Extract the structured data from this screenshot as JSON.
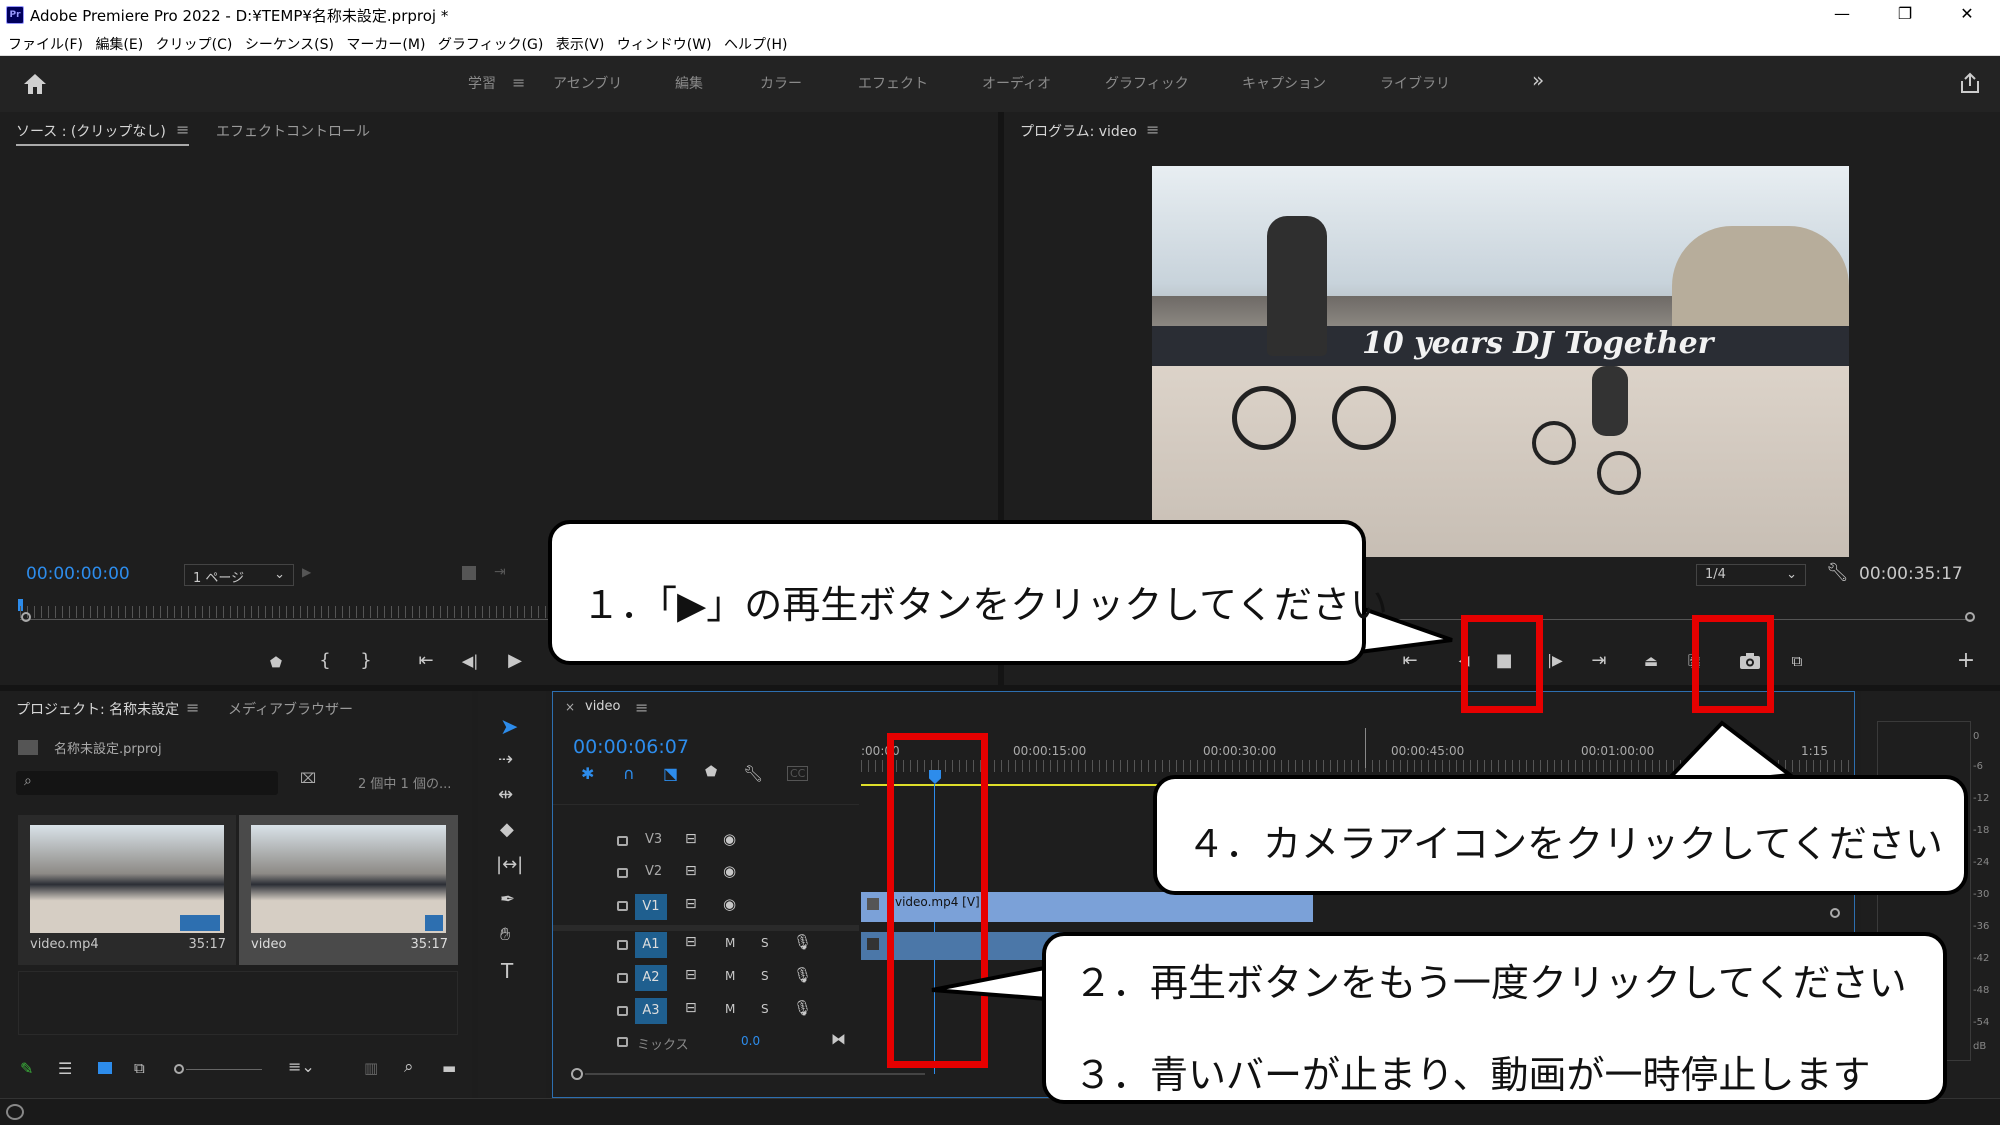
{
  "window": {
    "title": "Adobe Premiere Pro 2022 - D:¥TEMP¥名称未設定.prproj *",
    "app_icon": "Pr",
    "minimize": "—",
    "restore": "❐",
    "close": "✕"
  },
  "menu": [
    "ファイル(F)",
    "編集(E)",
    "クリップ(C)",
    "シーケンス(S)",
    "マーカー(M)",
    "グラフィック(G)",
    "表示(V)",
    "ウィンドウ(W)",
    "ヘルプ(H)"
  ],
  "workspaces": {
    "active": "学習",
    "items": [
      "アセンブリ",
      "編集",
      "カラー",
      "エフェクト",
      "オーディオ",
      "グラフィック",
      "キャプション",
      "ライブラリ"
    ],
    "more": "»"
  },
  "source_panel": {
    "tab_source": "ソース : (クリップなし)",
    "tab_effect_controls": "エフェクトコントロール",
    "timecode": "00:00:00:00",
    "page": "1 ページ"
  },
  "program_panel": {
    "tab": "プログラム: video",
    "zoom": "1/4",
    "duration": "00:00:35:17"
  },
  "project_panel": {
    "tab_project": "プロジェクト: 名称未設定",
    "tab_media": "メディアブラウザー",
    "project_file": "名称未設定.prproj",
    "search_placeholder": "",
    "count": "2 個中 1 個の...",
    "items": [
      {
        "name": "video.mp4",
        "duration": "35:17"
      },
      {
        "name": "video",
        "duration": "35:17"
      }
    ]
  },
  "timeline": {
    "tab": "video",
    "timecode": "00:00:06:07",
    "ruler": [
      ":00:00",
      "00:00:15:00",
      "00:00:30:00",
      "00:00:45:00",
      "00:01:00:00",
      "1:15"
    ],
    "video_tracks": [
      "V3",
      "V2",
      "V1"
    ],
    "audio_tracks": [
      "A1",
      "A2",
      "A3"
    ],
    "mix_label": "ミックス",
    "mix_value": "0.0",
    "clip_video": "video.mp4 [V]",
    "m": "M",
    "s": "S"
  },
  "meter_labels": [
    "0",
    "-6",
    "-12",
    "-18",
    "-24",
    "-30",
    "-36",
    "-42",
    "-48",
    "-54",
    "dB"
  ],
  "callouts": {
    "c1": "１．「▶」の再生ボタンをクリックしてください",
    "c2": "２．再生ボタンをもう一度クリックしてください",
    "c3": "３．青いバーが止まり、動画が一時停止します",
    "c4": "４．カメラアイコンをクリックしてください"
  },
  "video_overlay_text": "10 years DJ Together"
}
